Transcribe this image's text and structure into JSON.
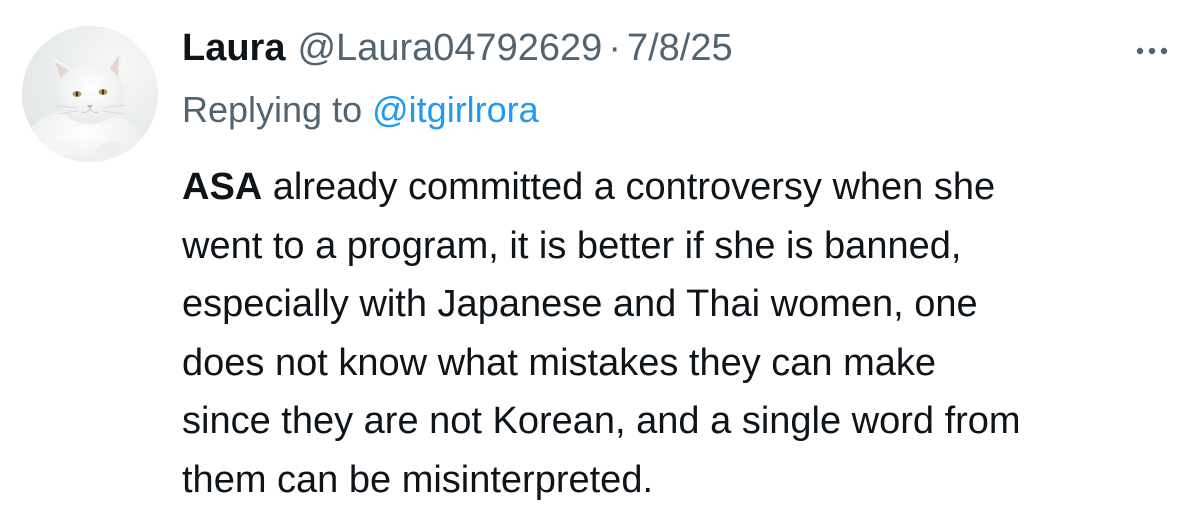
{
  "tweet": {
    "display_name": "Laura",
    "handle": "@Laura04792629",
    "separator": "·",
    "date": "7/8/25",
    "more_icon": "more-horizontal-icon",
    "avatar_icon": "cat-avatar",
    "reply": {
      "prefix": "Replying to",
      "mention": "@itgirlrora"
    },
    "body": {
      "bold_word": "ASA",
      "lines": [
        " already committed a controversy when she",
        "went to a program, it is better if she is banned,",
        "especially with Japanese and Thai women, one",
        "does not know what mistakes they can make",
        "since they are not Korean, and a single word from",
        "them can be misinterpreted."
      ]
    },
    "colors": {
      "text": "#0f1419",
      "secondary": "#536471",
      "link": "#1d9bf0"
    }
  }
}
